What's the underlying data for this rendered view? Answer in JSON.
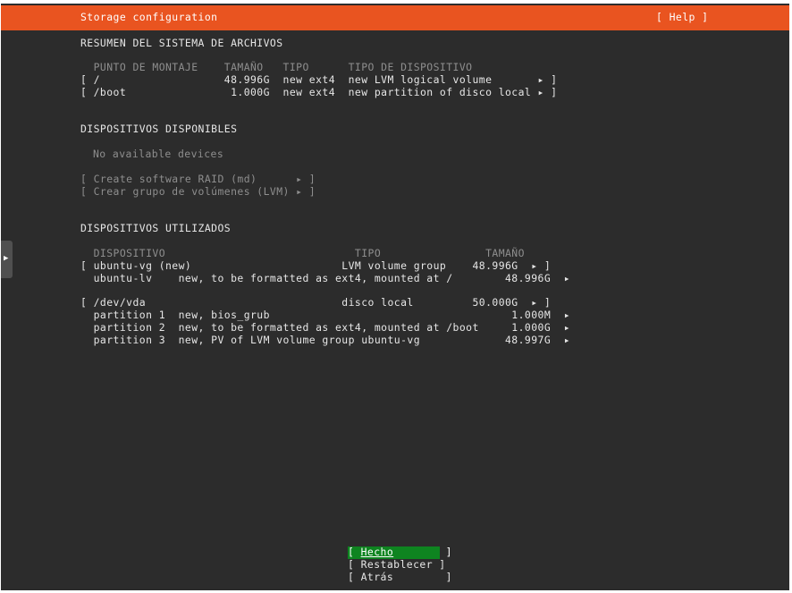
{
  "header": {
    "title": "Storage configuration",
    "help_label": "[ Help ]"
  },
  "filesystem_summary": {
    "heading": "RESUMEN DEL SISTEMA DE ARCHIVOS",
    "columns": "  PUNTO DE MONTAJE    TAMAÑO   TIPO      TIPO DE DISPOSITIVO",
    "rows": [
      "[ /                   48.996G  new ext4  new LVM logical volume       ▸ ]",
      "[ /boot                1.000G  new ext4  new partition of disco local ▸ ]"
    ]
  },
  "available_devices": {
    "heading": "DISPOSITIVOS DISPONIBLES",
    "empty_text": "No available devices",
    "actions": [
      "[ Create software RAID (md)      ▸ ]",
      "[ Crear grupo de volúmenes (LVM) ▸ ]"
    ]
  },
  "used_devices": {
    "heading": "DISPOSITIVOS UTILIZADOS",
    "columns": "  DISPOSITIVO                             TIPO                TAMAÑO",
    "groups": [
      {
        "device": "[ ubuntu-vg (new)                       LVM volume group    48.996G  ▸ ]",
        "children": [
          "  ubuntu-lv    new, to be formatted as ext4, mounted at /        48.996G  ▸"
        ]
      },
      {
        "device": "[ /dev/vda                              disco local         50.000G  ▸ ]",
        "children": [
          "  partition 1  new, bios_grub                                     1.000M  ▸",
          "  partition 2  new, to be formatted as ext4, mounted at /boot     1.000G  ▸",
          "  partition 3  new, PV of LVM volume group ubuntu-vg             48.997G  ▸"
        ]
      }
    ]
  },
  "footer": {
    "done": {
      "open": "[ ",
      "label": "Hecho",
      "close": "        ]"
    },
    "reset_label": "[ Restablecer ]",
    "back_label": "[ Atrás        ]"
  },
  "side_tab": {
    "icon": "triangle-right-icon",
    "glyph": "▶"
  },
  "colors": {
    "header": "#e95420",
    "background": "#2c2c2c",
    "done_button": "#0e8420",
    "text": "#e6e6e6",
    "dim": "#8e8e8e"
  }
}
